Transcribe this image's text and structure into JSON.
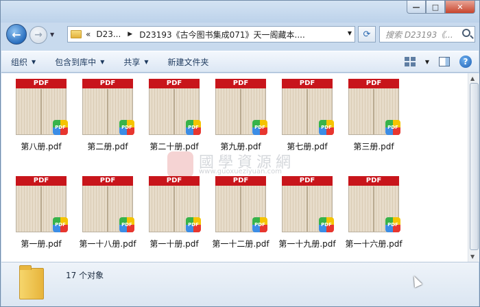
{
  "window": {
    "buttons": {
      "minimize": "—",
      "maximize": "□",
      "close": "✕"
    }
  },
  "nav": {
    "back_icon": "back-arrow-icon",
    "forward_icon": "forward-arrow-icon",
    "address": {
      "overflow_chevron": "«",
      "crumbs": [
        "D23...",
        "D23193《古今图书集成071》天一阁藏本...."
      ]
    },
    "search_placeholder": "搜索 D23193《..."
  },
  "toolbar": {
    "organize": "组织",
    "include_in_library": "包含到库中",
    "share": "共享",
    "new_folder": "新建文件夹"
  },
  "files": [
    {
      "name": "第八册.pdf"
    },
    {
      "name": "第二册.pdf"
    },
    {
      "name": "第二十册.pdf"
    },
    {
      "name": "第九册.pdf"
    },
    {
      "name": "第七册.pdf"
    },
    {
      "name": "第三册.pdf"
    },
    {
      "name": "第一册.pdf"
    },
    {
      "name": "第一十八册.pdf"
    },
    {
      "name": "第一十册.pdf"
    },
    {
      "name": "第一十二册.pdf"
    },
    {
      "name": "第一十九册.pdf"
    },
    {
      "name": "第一十六册.pdf"
    }
  ],
  "file_badge_label": "PDF",
  "watermark": {
    "text": "國學資源網",
    "url": "www.guoxueziyuan.com"
  },
  "status": {
    "count": "17 个对象"
  }
}
